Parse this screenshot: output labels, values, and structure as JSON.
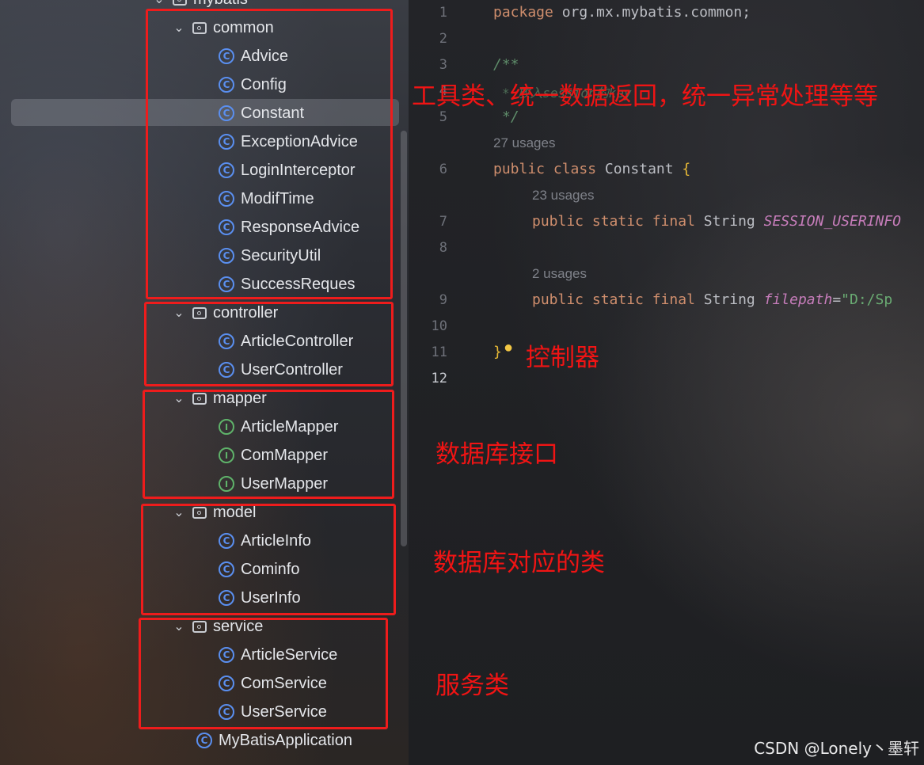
{
  "project_tree": {
    "root_label": "mybatis",
    "packages": [
      {
        "name": "common",
        "classes": [
          "Advice",
          "Config",
          "Constant",
          "ExceptionAdvice",
          "LoginInterceptor",
          "ModifTime",
          "ResponseAdvice",
          "SecurityUtil",
          "SuccessReques"
        ]
      },
      {
        "name": "controller",
        "classes": [
          "ArticleController",
          "UserController"
        ]
      },
      {
        "name": "mapper",
        "interfaces": [
          "ArticleMapper",
          "ComMapper",
          "UserMapper"
        ]
      },
      {
        "name": "model",
        "classes": [
          "ArticleInfo",
          "Cominfo",
          "UserInfo"
        ]
      },
      {
        "name": "service",
        "classes": [
          "ArticleService",
          "ComService",
          "UserService"
        ]
      }
    ],
    "app_class": "MyBatisApplication",
    "selected_item": "Constant"
  },
  "annotations": {
    "common": "工具类、统一数据返回，统一异常处理等等",
    "controller": "控制器",
    "mapper": "数据库接口",
    "model": "数据库对应的类",
    "service": "服务类"
  },
  "editor": {
    "line_numbers": [
      "1",
      "2",
      "3",
      "4",
      "5",
      "6",
      "7",
      "8",
      "9",
      "10",
      "11",
      "12"
    ],
    "line1": {
      "kw": "package",
      "rest": " org.mx.mybatis.common;"
    },
    "line3": "/**",
    "line4": "* 放入session的key",
    "line5": "*/",
    "usage_class": "27 usages",
    "line6": {
      "kw": "public class",
      "name": " Constant ",
      "brace": "{"
    },
    "usage_field1": "23 usages",
    "line7": {
      "kw": "public static final",
      "type": " String ",
      "field": "SESSION_USERINFO"
    },
    "usage_field2": "2 usages",
    "line9": {
      "kw": "public static final",
      "type": " String ",
      "field": "filepath",
      "eq": "=",
      "value": "\"D:/Sp"
    },
    "line11": "}"
  },
  "watermark": "CSDN @Lonely丶墨轩",
  "colors": {
    "annotation": "#f01414",
    "class_icon": "#5a8ff0",
    "interface_icon": "#5fb36a",
    "keyword": "#cf8e6d",
    "field": "#c77dbb",
    "string": "#6aab73"
  }
}
